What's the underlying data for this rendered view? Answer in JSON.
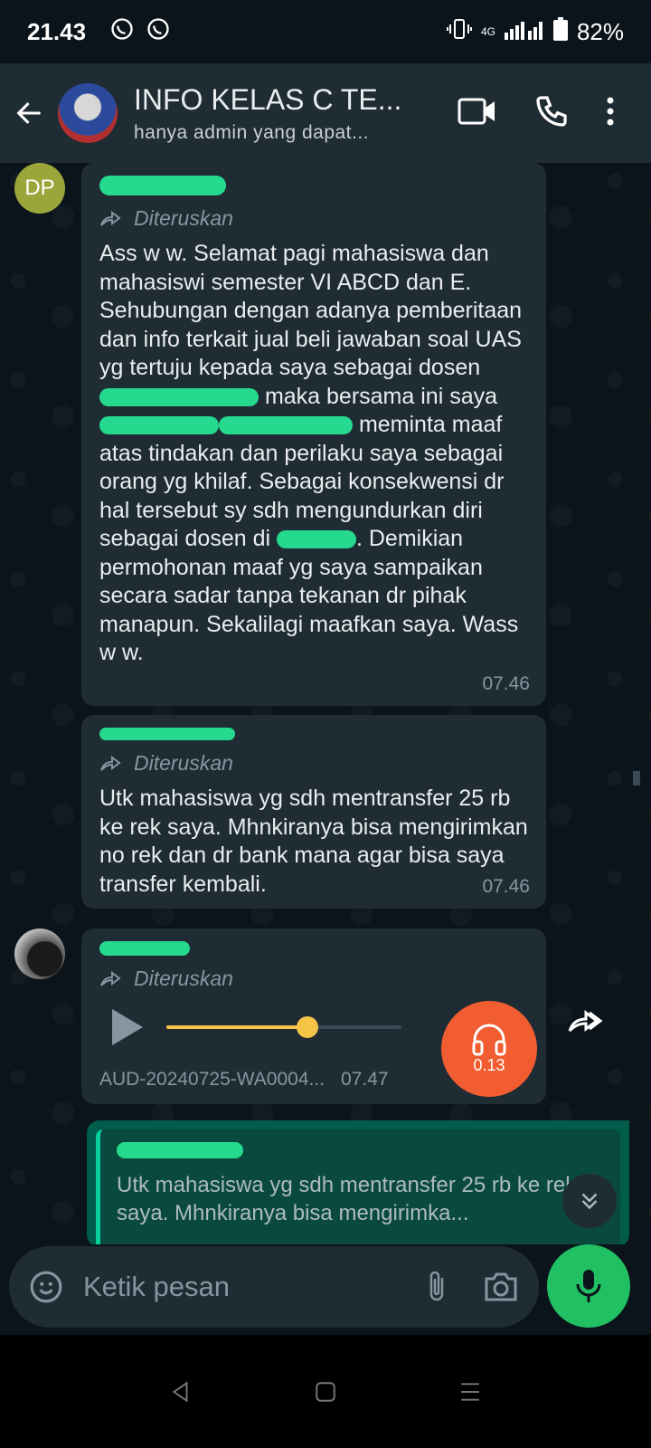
{
  "status_bar": {
    "time": "21.43",
    "network": "4G",
    "battery": "82%"
  },
  "header": {
    "title": "INFO KELAS C TE...",
    "subtitle": "hanya admin yang dapat..."
  },
  "messages": [
    {
      "avatar_initials": "DP",
      "forwarded_label": "Diteruskan",
      "text_parts": [
        "Ass w w. Selamat pagi mahasiswa dan  mahasiswi semester VI ABCD dan E. Sehubungan dengan  adanya pemberitaan  dan info terkait jual beli jawaban soal UAS yg tertuju kepada saya sebagai dosen ",
        " maka   bersama ini saya ",
        " meminta maaf atas tindakan dan perilaku saya sebagai orang yg khilaf. Sebagai konsekwensi dr hal tersebut sy sdh mengundurkan diri sebagai dosen di ",
        ". Demikian permohonan maaf yg saya sampaikan secara sadar tanpa tekanan dr pihak manapun. Sekalilagi maafkan saya. Wass w w."
      ],
      "time": "07.46"
    },
    {
      "forwarded_label": "Diteruskan",
      "text": "Utk mahasiswa yg sdh mentransfer 25 rb ke rek saya. Mhnkiranya bisa mengirimkan no rek dan dr bank mana agar bisa saya transfer kembali.",
      "time": "07.46"
    },
    {
      "forwarded_label": "Diteruskan",
      "audio": {
        "filename": "AUD-20240725-WA0004...",
        "time": "07.47",
        "duration": "0.13",
        "progress": 0.6
      }
    }
  ],
  "outgoing_quote": {
    "text": "Utk mahasiswa yg sdh mentransfer 25 rb ke rek saya. Mhnkiranya bisa mengirimka..."
  },
  "composer": {
    "placeholder": "Ketik pesan"
  },
  "colors": {
    "background": "#0b141a",
    "bubble_in": "#1f2c33",
    "bubble_out": "#005c4b",
    "accent": "#21c063",
    "audio": "#f15c30",
    "redaction": "#25d98f"
  }
}
